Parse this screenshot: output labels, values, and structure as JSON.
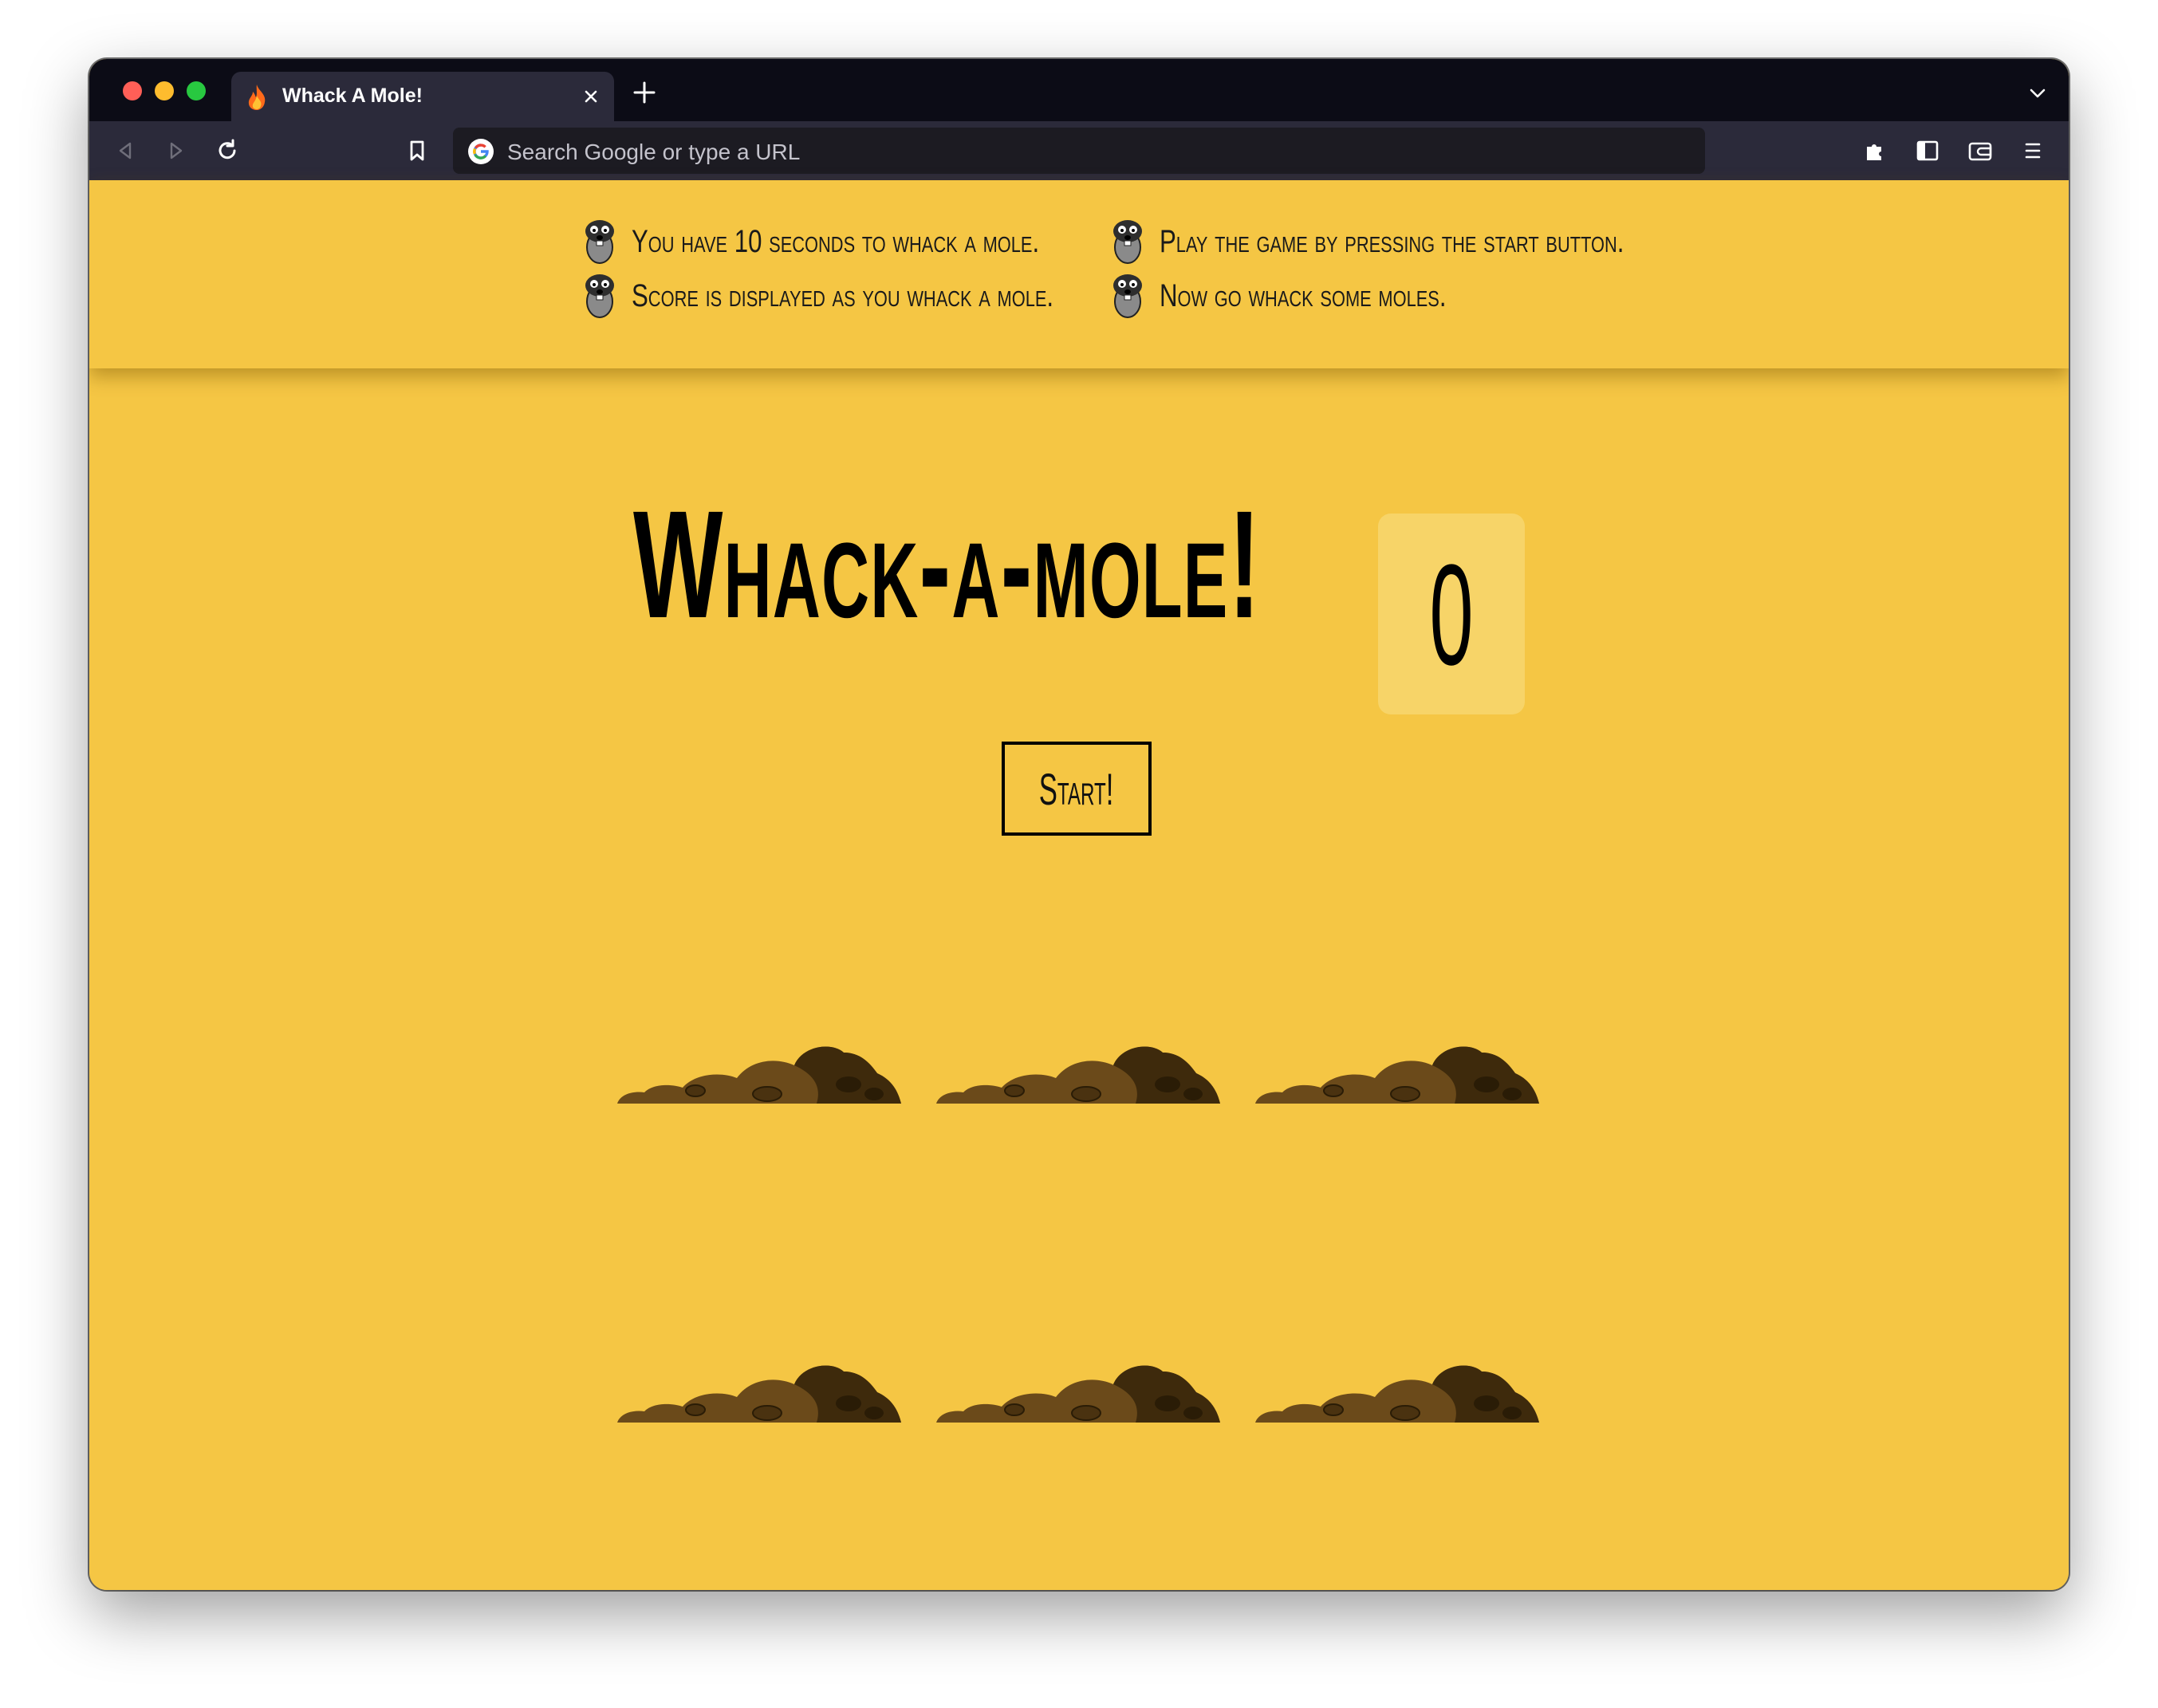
{
  "browser": {
    "tab_title": "Whack A Mole!",
    "url_placeholder": "Search Google or type a URL",
    "icons": [
      "flame-favicon-icon",
      "close-icon",
      "plus-icon",
      "chevron-down-icon",
      "back-icon",
      "forward-icon",
      "reload-icon",
      "bookmark-icon",
      "google-icon",
      "extensions-icon",
      "sidebar-icon",
      "wallet-icon",
      "menu-icon"
    ]
  },
  "rules": [
    "You have 10 seconds to whack a mole.",
    "Score is displayed as you whack a mole.",
    "Play the game by pressing the start button.",
    "Now go whack some moles."
  ],
  "game": {
    "title": "Whack-a-mole!",
    "score": "0",
    "start_label": "Start!"
  },
  "colors": {
    "page_background": "#f5c644",
    "score_background": "#f7d468",
    "dirt": "#6b4a1a"
  }
}
